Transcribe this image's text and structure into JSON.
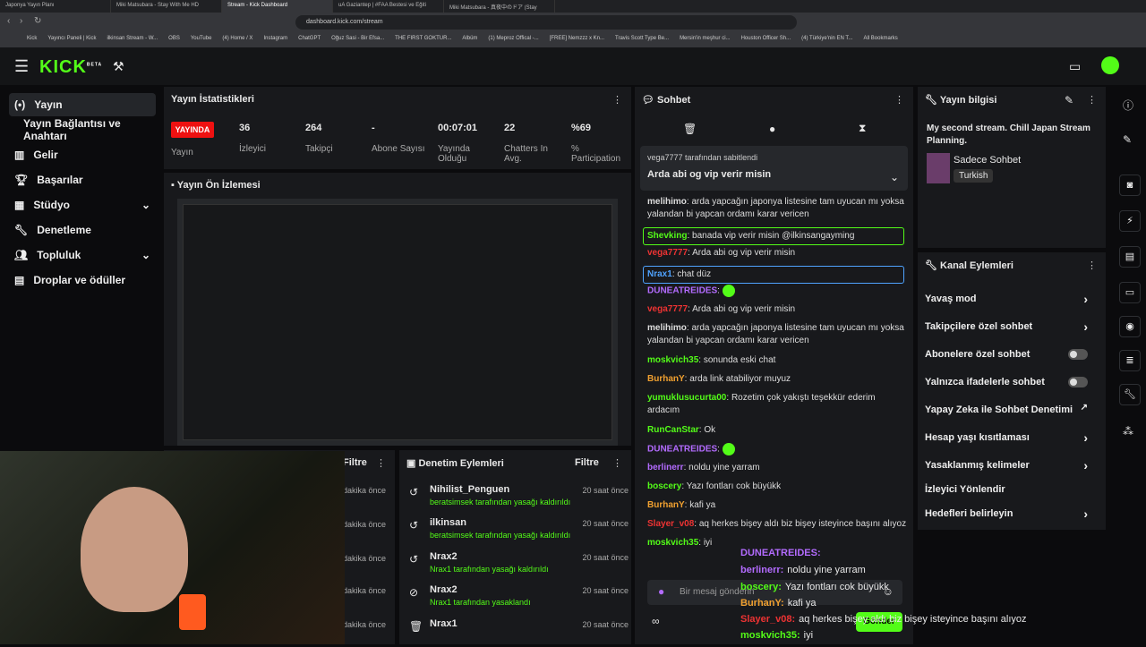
{
  "browser": {
    "tabs": [
      "Japonya Yayın Planı",
      "Miki Matsubara - Stay With Me HD",
      "Stream - Kick Dashboard",
      "uA Gaziantep | #FAA Bestesi ve Eğiti",
      "Miki Matsubara - 真夜中のドア (Stay"
    ],
    "url": "dashboard.kick.com/stream",
    "bookmarks": [
      "Kick",
      "Yayıncı Paneli | Kick",
      "ilkinsan Stream - W...",
      "OBS",
      "YouTube",
      "(4) Home / X",
      "Instagram",
      "ChatGPT",
      "Oğuz Sasi - Bir Efsa...",
      "THE FIRST GOKTUR...",
      "Albüm",
      "(1) Meproz Offical -...",
      "[FREE] Nemzzz x Kn...",
      "Travis Scott Type Be...",
      "Mersin'in meşhur ci...",
      "Houston Officer Sh...",
      "(4) Türkiye'nin EN T...",
      "All Bookmarks"
    ]
  },
  "app": {
    "logo": "KICK",
    "logo_sup": "BETA"
  },
  "nav": [
    {
      "label": "Yayın",
      "icon": "broadcast-icon"
    },
    {
      "label": "Yayın Bağlantısı ve Anahtarı"
    },
    {
      "label": "Gelir",
      "icon": "chart-icon"
    },
    {
      "label": "Başarılar",
      "icon": "trophy-icon"
    },
    {
      "label": "Stüdyo",
      "icon": "studio-icon"
    },
    {
      "label": "Denetleme",
      "icon": "wrench-icon"
    },
    {
      "label": "Topluluk",
      "icon": "people-icon"
    },
    {
      "label": "Droplar ve ödüller",
      "icon": "gift-icon"
    }
  ],
  "stats": {
    "title": "Yayın İstatistikleri",
    "live_label": "YAYINDA",
    "live_sub": "Yayın",
    "items": [
      {
        "v": "36",
        "l": "İzleyici"
      },
      {
        "v": "264",
        "l": "Takipçi"
      },
      {
        "v": "-",
        "l": "Abone Sayısı"
      },
      {
        "v": "00:07:01",
        "l": "Yayında Olduğu"
      },
      {
        "v": "22",
        "l": "Chatters In Avg."
      },
      {
        "v": "%69",
        "l": "% Participation"
      }
    ]
  },
  "preview": {
    "title": "Yayın Ön İzlemesi"
  },
  "chat": {
    "title": "Sohbet",
    "pinned_by": "vega7777 tarafından sabitlendi",
    "pinned_msg": "Arda abi og vip verir misin",
    "placeholder": "Bir mesaj gönderin",
    "lines": [
      {
        "u": "melihimo",
        "c": "#ddd",
        "t": "arda yapcağın japonya listesine tam uyucan mı yoksa yalandan bi yapcan ordamı karar vericen"
      },
      {
        "u": "Shevking",
        "c": "#53fc18",
        "t": "banada vip verir misin @ilkinsangayming"
      },
      {
        "u": "vega7777",
        "c": "#e33",
        "t": "Arda abi og vip verir misin"
      },
      {
        "u": "Nrax1",
        "c": "#4fa3ff",
        "t": "chat düz"
      },
      {
        "u": "DUNEATREIDES",
        "c": "#b36bff",
        "t": ""
      },
      {
        "u": "vega7777",
        "c": "#e33",
        "t": "Arda abi og vip verir misin"
      },
      {
        "u": "melihimo",
        "c": "#ddd",
        "t": "arda yapcağın japonya listesine tam uyucan mı yoksa yalandan bi yapcan ordamı karar vericen"
      },
      {
        "u": "moskvich35",
        "c": "#53fc18",
        "t": "sonunda eski chat"
      },
      {
        "u": "BurhanY",
        "c": "#f0a030",
        "t": "arda link atabiliyor muyuz"
      },
      {
        "u": "yumuklusucurta00",
        "c": "#53fc18",
        "t": "Rozetim çok yakıştı teşekkür ederim ardacım"
      },
      {
        "u": "RunCanStar",
        "c": "#53fc18",
        "t": "Ok"
      },
      {
        "u": "DUNEATREIDES",
        "c": "#b36bff",
        "t": ""
      },
      {
        "u": "berlinerr",
        "c": "#b36bff",
        "t": "noldu yine yarram"
      },
      {
        "u": "boscery",
        "c": "#53fc18",
        "t": "Yazı fontları cok büyükk"
      },
      {
        "u": "BurhanY",
        "c": "#f0a030",
        "t": "kafi ya"
      },
      {
        "u": "Slayer_v08",
        "c": "#e33",
        "t": "aq herkes bişey aldı biz bişey isteyince başını alıyoz"
      },
      {
        "u": "moskvich35",
        "c": "#53fc18",
        "t": "iyi"
      }
    ]
  },
  "info": {
    "title": "Yayın bilgisi",
    "stream_title": "My second stream. Chill Japan Stream Planning.",
    "category": "Sadece Sohbet",
    "tag": "Turkish"
  },
  "channel": {
    "title": "Kanal Eylemleri",
    "items": [
      {
        "l": "Yavaş mod",
        "k": "arrow"
      },
      {
        "l": "Takipçilere özel sohbet",
        "k": "arrow"
      },
      {
        "l": "Abonelere özel sohbet",
        "k": "toggle"
      },
      {
        "l": "Yalnızca ifadelerle sohbet",
        "k": "toggle"
      },
      {
        "l": "Yapay Zeka ile Sohbet Denetimi",
        "k": "ext"
      },
      {
        "l": "Hesap yaşı kısıtlaması",
        "k": "arrow"
      },
      {
        "l": "Yasaklanmış kelimeler",
        "k": "arrow"
      },
      {
        "l": "İzleyici Yönlendir",
        "k": "none"
      },
      {
        "l": "Hedefleri belirleyin",
        "k": "arrow"
      }
    ]
  },
  "mod": {
    "title": "Denetim Eylemleri",
    "filter": "Filtre",
    "rows": [
      {
        "n": "Nihilist_Penguen",
        "s": "beratsimsek tarafından yasağı kaldırıldı",
        "t": "20 saat önce",
        "i": "undo-icon"
      },
      {
        "n": "ilkinsan",
        "s": "beratsimsek tarafından yasağı kaldırıldı",
        "t": "20 saat önce",
        "i": "undo-icon"
      },
      {
        "n": "Nrax2",
        "s": "Nrax1 tarafından yasağı kaldırıldı",
        "t": "20 saat önce",
        "i": "undo-icon"
      },
      {
        "n": "Nrax2",
        "s": "Nrax1 tarafından yasaklandı",
        "t": "20 saat önce",
        "i": "ban-icon"
      },
      {
        "n": "Nrax1",
        "s": "",
        "t": "20 saat önce",
        "i": "trash-icon"
      }
    ]
  },
  "left_filter": {
    "filter": "Filtre",
    "times": [
      "dakika önce",
      "dakika önce",
      "dakika önce",
      "dakika önce",
      "dakika önce"
    ]
  },
  "overlay_chat": [
    {
      "u": "DUNEATREIDES:",
      "t": ""
    },
    {
      "u": "berlinerr:",
      "t": "noldu yine yarram"
    },
    {
      "u": "boscery:",
      "t": "Yazı fontları cok büyükk"
    },
    {
      "u": "BurhanY:",
      "t": "kafi ya"
    },
    {
      "u": "Slayer_v08:",
      "t": "aq herkes bişey aldı biz bişey isteyince başını alıyoz"
    },
    {
      "u": "moskvich35:",
      "t": "iyi"
    }
  ],
  "send": "Gönder"
}
